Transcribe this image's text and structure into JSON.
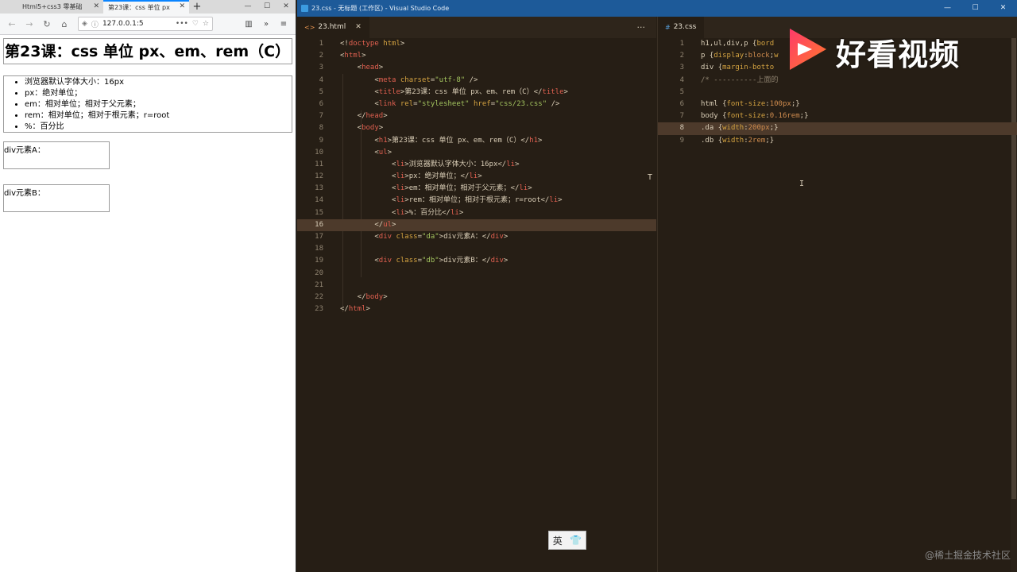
{
  "browser": {
    "tabs": [
      {
        "title": "Html5+css3 零基础"
      },
      {
        "title": "第23课：css 单位 px"
      }
    ],
    "new_tab": "+",
    "url": "127.0.0.1:5",
    "page": {
      "h1": "第23课：css 单位 px、em、rem（C）",
      "list": [
        "浏览器默认字体大小：16px",
        "px：绝对单位；",
        "em：相对单位；相对于父元素；",
        "rem：相对单位；相对于根元素；r=root",
        "%：百分比"
      ],
      "div_a": "div元素A：",
      "div_b": "div元素B："
    }
  },
  "vscode": {
    "window_title": "23.css - 无标题 (工作区) - Visual Studio Code",
    "left_tab": "23.html",
    "right_tab": "23.css",
    "html_lines": [
      {
        "n": "1",
        "parts": [
          [
            "c-txt",
            "<!"
          ],
          [
            "c-tag",
            "doctype"
          ],
          [
            "c-attr",
            " html"
          ],
          [
            "c-txt",
            ">"
          ]
        ]
      },
      {
        "n": "2",
        "parts": [
          [
            "c-txt",
            "<"
          ],
          [
            "c-tag",
            "html"
          ],
          [
            "c-txt",
            ">"
          ]
        ]
      },
      {
        "n": "3",
        "parts": [
          [
            "c-txt",
            "    <"
          ],
          [
            "c-tag",
            "head"
          ],
          [
            "c-txt",
            ">"
          ]
        ]
      },
      {
        "n": "4",
        "parts": [
          [
            "c-txt",
            "        <"
          ],
          [
            "c-tag",
            "meta"
          ],
          [
            "c-attr",
            " charset"
          ],
          [
            "c-txt",
            "="
          ],
          [
            "c-str",
            "\"utf-8\""
          ],
          [
            "c-txt",
            " />"
          ]
        ]
      },
      {
        "n": "5",
        "parts": [
          [
            "c-txt",
            "        <"
          ],
          [
            "c-tag",
            "title"
          ],
          [
            "c-txt",
            ">第23课：css 单位 px、em、rem（C）</"
          ],
          [
            "c-tag",
            "title"
          ],
          [
            "c-txt",
            ">"
          ]
        ]
      },
      {
        "n": "6",
        "parts": [
          [
            "c-txt",
            "        <"
          ],
          [
            "c-tag",
            "link"
          ],
          [
            "c-attr",
            " rel"
          ],
          [
            "c-txt",
            "="
          ],
          [
            "c-str",
            "\"stylesheet\""
          ],
          [
            "c-attr",
            " href"
          ],
          [
            "c-txt",
            "="
          ],
          [
            "c-str",
            "\"css/23.css\""
          ],
          [
            "c-txt",
            " />"
          ]
        ]
      },
      {
        "n": "7",
        "parts": [
          [
            "c-txt",
            "    </"
          ],
          [
            "c-tag",
            "head"
          ],
          [
            "c-txt",
            ">"
          ]
        ]
      },
      {
        "n": "8",
        "parts": [
          [
            "c-txt",
            "    <"
          ],
          [
            "c-tag",
            "body"
          ],
          [
            "c-txt",
            ">"
          ]
        ]
      },
      {
        "n": "9",
        "parts": [
          [
            "c-txt",
            "        <"
          ],
          [
            "c-tag",
            "h1"
          ],
          [
            "c-txt",
            ">第23课：css 单位 px、em、rem（C）</"
          ],
          [
            "c-tag",
            "h1"
          ],
          [
            "c-txt",
            ">"
          ]
        ]
      },
      {
        "n": "10",
        "parts": [
          [
            "c-txt",
            "        <"
          ],
          [
            "c-tag",
            "ul"
          ],
          [
            "c-txt",
            ">"
          ]
        ]
      },
      {
        "n": "11",
        "parts": [
          [
            "c-txt",
            "            <"
          ],
          [
            "c-tag",
            "li"
          ],
          [
            "c-txt",
            ">浏览器默认字体大小：16px</"
          ],
          [
            "c-tag",
            "li"
          ],
          [
            "c-txt",
            ">"
          ]
        ]
      },
      {
        "n": "12",
        "parts": [
          [
            "c-txt",
            "            <"
          ],
          [
            "c-tag",
            "li"
          ],
          [
            "c-txt",
            ">px：绝对单位；</"
          ],
          [
            "c-tag",
            "li"
          ],
          [
            "c-txt",
            ">"
          ]
        ]
      },
      {
        "n": "13",
        "parts": [
          [
            "c-txt",
            "            <"
          ],
          [
            "c-tag",
            "li"
          ],
          [
            "c-txt",
            ">em：相对单位；相对于父元素；</"
          ],
          [
            "c-tag",
            "li"
          ],
          [
            "c-txt",
            ">"
          ]
        ]
      },
      {
        "n": "14",
        "parts": [
          [
            "c-txt",
            "            <"
          ],
          [
            "c-tag",
            "li"
          ],
          [
            "c-txt",
            ">rem：相对单位；相对于根元素；r=root</"
          ],
          [
            "c-tag",
            "li"
          ],
          [
            "c-txt",
            ">"
          ]
        ]
      },
      {
        "n": "15",
        "parts": [
          [
            "c-txt",
            "            <"
          ],
          [
            "c-tag",
            "li"
          ],
          [
            "c-txt",
            ">%：百分比</"
          ],
          [
            "c-tag",
            "li"
          ],
          [
            "c-txt",
            ">"
          ]
        ]
      },
      {
        "n": "16",
        "parts": [
          [
            "c-txt",
            "        </"
          ],
          [
            "c-tag",
            "ul"
          ],
          [
            "c-txt",
            ">"
          ]
        ]
      },
      {
        "n": "17",
        "parts": [
          [
            "c-txt",
            "        <"
          ],
          [
            "c-tag",
            "div"
          ],
          [
            "c-attr",
            " class"
          ],
          [
            "c-txt",
            "="
          ],
          [
            "c-str",
            "\"da\""
          ],
          [
            "c-txt",
            ">div元素A：</"
          ],
          [
            "c-tag",
            "div"
          ],
          [
            "c-txt",
            ">"
          ]
        ]
      },
      {
        "n": "18",
        "parts": []
      },
      {
        "n": "19",
        "parts": [
          [
            "c-txt",
            "        <"
          ],
          [
            "c-tag",
            "div"
          ],
          [
            "c-attr",
            " class"
          ],
          [
            "c-txt",
            "="
          ],
          [
            "c-str",
            "\"db\""
          ],
          [
            "c-txt",
            ">div元素B：</"
          ],
          [
            "c-tag",
            "div"
          ],
          [
            "c-txt",
            ">"
          ]
        ]
      },
      {
        "n": "20",
        "parts": []
      },
      {
        "n": "21",
        "parts": []
      },
      {
        "n": "22",
        "parts": [
          [
            "c-txt",
            "    </"
          ],
          [
            "c-tag",
            "body"
          ],
          [
            "c-txt",
            ">"
          ]
        ]
      },
      {
        "n": "23",
        "parts": [
          [
            "c-txt",
            "</"
          ],
          [
            "c-tag",
            "html"
          ],
          [
            "c-txt",
            ">"
          ]
        ]
      }
    ],
    "css_lines": [
      {
        "n": "1",
        "parts": [
          [
            "c-sel",
            "h1,ul,div,p "
          ],
          [
            "c-txt",
            "{"
          ],
          [
            "c-kw",
            "bord"
          ]
        ]
      },
      {
        "n": "2",
        "parts": [
          [
            "c-sel",
            "p "
          ],
          [
            "c-txt",
            "{"
          ],
          [
            "c-kw",
            "display"
          ],
          [
            "c-txt",
            ":"
          ],
          [
            "c-val",
            "block"
          ],
          [
            "c-txt",
            ";"
          ],
          [
            "c-kw",
            "w"
          ]
        ]
      },
      {
        "n": "3",
        "parts": [
          [
            "c-sel",
            "div "
          ],
          [
            "c-txt",
            "{"
          ],
          [
            "c-kw",
            "margin-botto"
          ]
        ]
      },
      {
        "n": "4",
        "parts": [
          [
            "c-cmt",
            "/* ----------上面的"
          ]
        ]
      },
      {
        "n": "5",
        "parts": []
      },
      {
        "n": "6",
        "parts": [
          [
            "c-sel",
            "html "
          ],
          [
            "c-txt",
            "{"
          ],
          [
            "c-kw",
            "font-size"
          ],
          [
            "c-txt",
            ":"
          ],
          [
            "c-val",
            "100px"
          ],
          [
            "c-txt",
            ";}"
          ]
        ]
      },
      {
        "n": "7",
        "parts": [
          [
            "c-sel",
            "body "
          ],
          [
            "c-txt",
            "{"
          ],
          [
            "c-kw",
            "font-size"
          ],
          [
            "c-txt",
            ":"
          ],
          [
            "c-val",
            "0.16rem"
          ],
          [
            "c-txt",
            ";}"
          ]
        ]
      },
      {
        "n": "8",
        "parts": [
          [
            "c-sel",
            ".da "
          ],
          [
            "c-txt",
            "{"
          ],
          [
            "c-kw",
            "width"
          ],
          [
            "c-txt",
            ":"
          ],
          [
            "c-val",
            "200px"
          ],
          [
            "c-txt",
            ";}"
          ]
        ]
      },
      {
        "n": "9",
        "parts": [
          [
            "c-sel",
            ".db "
          ],
          [
            "c-txt",
            "{"
          ],
          [
            "c-kw",
            "width"
          ],
          [
            "c-txt",
            ":"
          ],
          [
            "c-val",
            "2rem"
          ],
          [
            "c-txt",
            ";}"
          ]
        ]
      }
    ],
    "html_current_line": "16",
    "css_current_line": "8"
  },
  "overlay": {
    "logo_text": "好看视频",
    "ime": [
      "英",
      "👕"
    ],
    "watermark": "@稀土掘金技术社区"
  }
}
